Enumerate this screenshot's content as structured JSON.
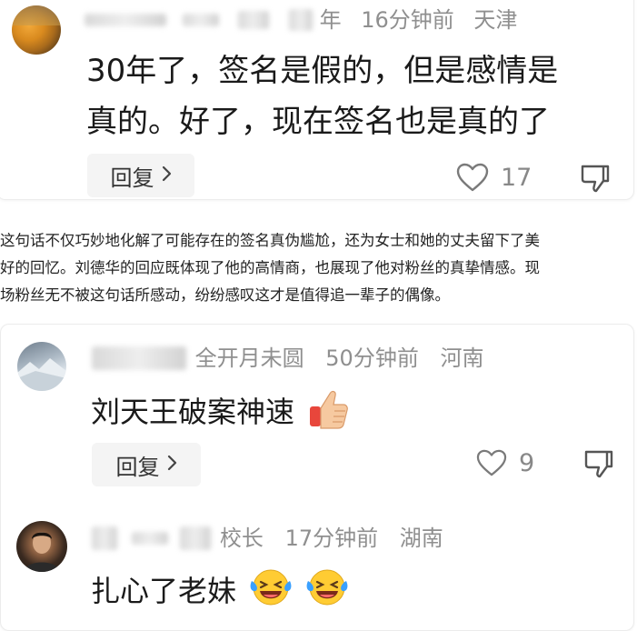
{
  "comments": [
    {
      "meta_visible": "年",
      "time": "16分钟前",
      "location": "天津",
      "text_line1": "30年了，签名是假的，但是感情是",
      "text_line2": "真的。好了，现在签名也是真的了",
      "reply_label": "回复",
      "likes": "17"
    },
    {
      "meta_visible": "全开月未圆",
      "time": "50分钟前",
      "location": "河南",
      "text": "刘天王破案神速",
      "reply_label": "回复",
      "likes": "9"
    },
    {
      "meta_visible": "校长",
      "time": "17分钟前",
      "location": "湖南",
      "text": "扎心了老妹"
    }
  ],
  "article": {
    "line1": "这句话不仅巧妙地化解了可能存在的签名真伪尴尬，还为女士和她的丈夫留下了美",
    "line2": "好的回忆。刘德华的回应既体现了他的高情商，也展现了他对粉丝的真挚情感。现",
    "line3": "场粉丝无不被这句话所感动，纷纷感叹这才是值得追一辈子的偶像。"
  },
  "icons": {
    "like": "heart-outline-icon",
    "dislike": "thumbs-down-icon",
    "reply_chevron": "chevron-right-icon",
    "emoji_thumb": "thumbs-up-emoji",
    "emoji_laugh": "laughing-crying-emoji"
  }
}
